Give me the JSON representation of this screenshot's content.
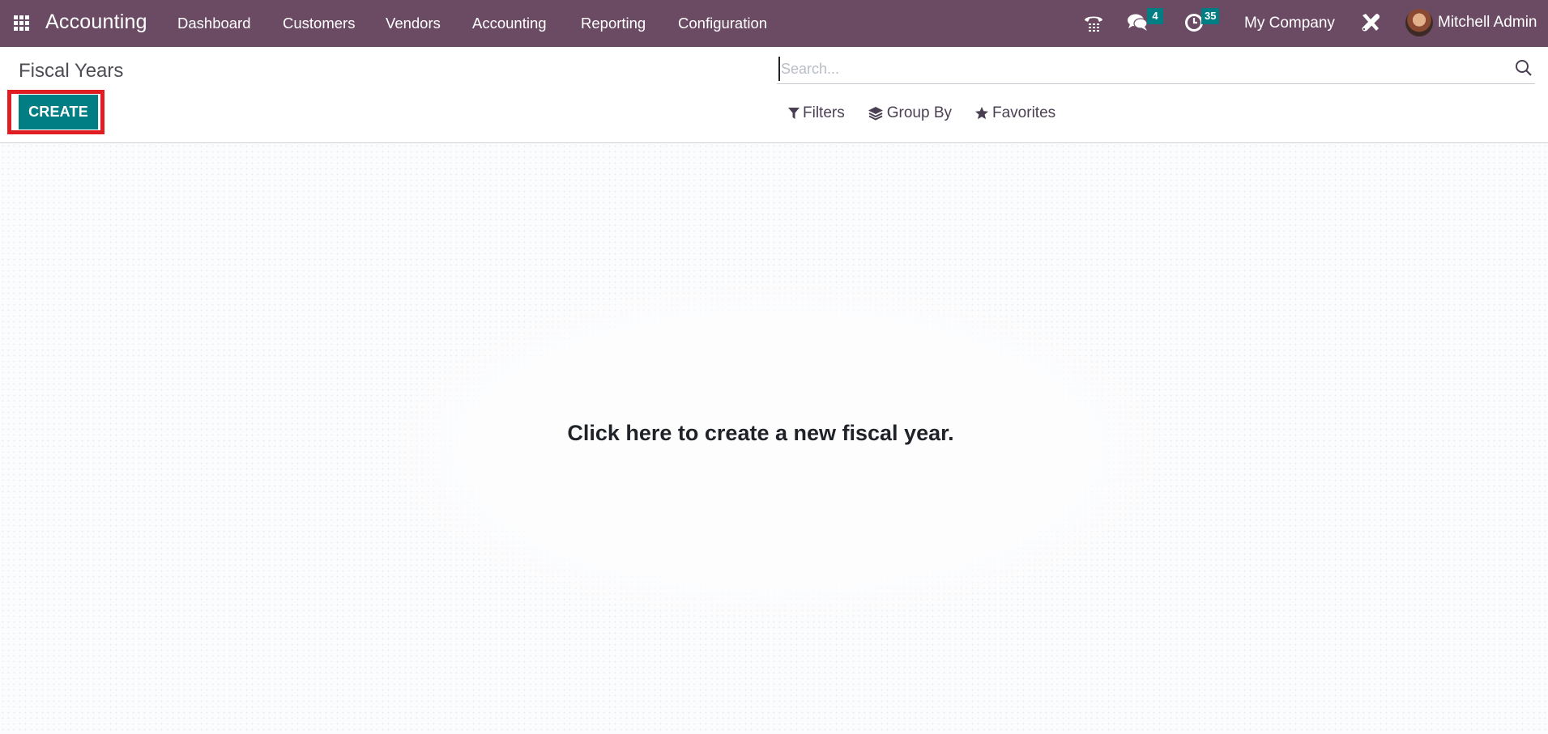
{
  "navbar": {
    "app_name": "Accounting",
    "menu": [
      {
        "label": "Dashboard"
      },
      {
        "label": "Customers"
      },
      {
        "label": "Vendors"
      },
      {
        "label": "Accounting"
      },
      {
        "label": "Reporting"
      },
      {
        "label": "Configuration"
      }
    ],
    "systray": {
      "phone_icon": "phone-icon",
      "messages_icon": "chat-bubbles-icon",
      "messages_count": "4",
      "activities_icon": "clock-icon",
      "activities_count": "35",
      "company": "My Company",
      "debug_icon": "tools-icon",
      "user_name": "Mitchell Admin"
    },
    "colors": {
      "bar": "#6b4b63",
      "badge": "#017e84"
    }
  },
  "control_panel": {
    "title": "Fiscal Years",
    "create_label": "CREATE",
    "search": {
      "placeholder": "Search...",
      "value": ""
    },
    "filters_label": "Filters",
    "group_by_label": "Group By",
    "favorites_label": "Favorites",
    "colors": {
      "primary": "#017e84",
      "highlight": "#e11d24"
    }
  },
  "content": {
    "help_text": "Click here to create a new fiscal year."
  }
}
